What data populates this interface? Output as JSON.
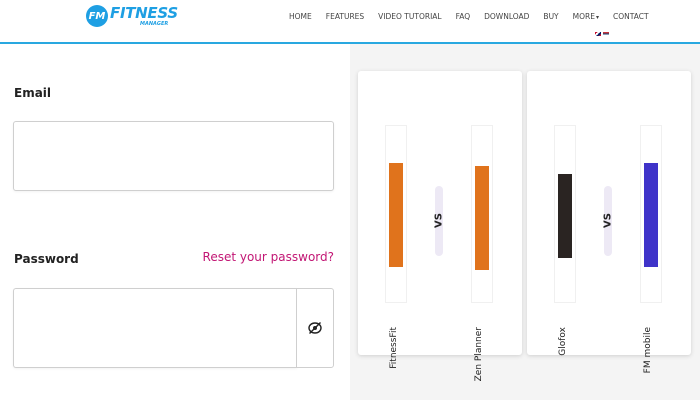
{
  "header": {
    "logo": {
      "badge": "FM",
      "word": "FITNESS",
      "sub": "MANAGER"
    },
    "nav": [
      {
        "label": "HOME"
      },
      {
        "label": "FEATURES"
      },
      {
        "label": "VIDEO TUTORIAL"
      },
      {
        "label": "FAQ"
      },
      {
        "label": "DOWNLOAD"
      },
      {
        "label": "BUY"
      },
      {
        "label": "MORE"
      },
      {
        "label": "CONTACT"
      }
    ],
    "more_caret": "▾",
    "accent_color": "#29a8e0"
  },
  "form": {
    "email_label": "Email",
    "email_value": "",
    "password_label": "Password",
    "password_value": "",
    "reset_link": "Reset your password?",
    "reset_color": "#c21674",
    "toggle_icon": "eye-slash-icon"
  },
  "comparisons": [
    {
      "left_app": {
        "name": "FitnessFit",
        "color": "#e0731c"
      },
      "vs": "VS",
      "right_app": {
        "name": "Zen Planner",
        "color": "#e0731c"
      }
    },
    {
      "left_app": {
        "name": "Glofox",
        "color": "#2a2422"
      },
      "vs": "VS",
      "right_app": {
        "name": "FM mobile",
        "color": "#3f33c9"
      }
    }
  ]
}
